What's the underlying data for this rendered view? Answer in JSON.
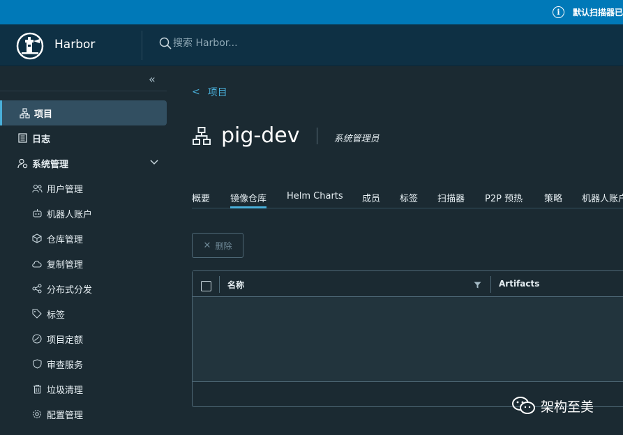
{
  "banner": {
    "message": "默认扫描器已",
    "icon": "info-icon"
  },
  "header": {
    "brand": "Harbor",
    "search_placeholder": "搜索 Harbor..."
  },
  "sidebar": {
    "collapse_icon": "double-chevron-left-icon",
    "items": [
      {
        "label": "项目",
        "icon": "project-icon",
        "active": true
      },
      {
        "label": "日志",
        "icon": "log-icon"
      },
      {
        "label": "系统管理",
        "icon": "admin-icon",
        "expanded": true
      }
    ],
    "sub_items": [
      {
        "label": "用户管理",
        "icon": "users-icon"
      },
      {
        "label": "机器人账户",
        "icon": "robot-icon"
      },
      {
        "label": "仓库管理",
        "icon": "cube-icon"
      },
      {
        "label": "复制管理",
        "icon": "cloud-icon"
      },
      {
        "label": "分布式分发",
        "icon": "share-icon"
      },
      {
        "label": "标签",
        "icon": "tag-icon"
      },
      {
        "label": "项目定额",
        "icon": "quota-icon"
      },
      {
        "label": "审查服务",
        "icon": "shield-icon"
      },
      {
        "label": "垃圾清理",
        "icon": "trash-icon"
      },
      {
        "label": "配置管理",
        "icon": "gear-icon"
      }
    ]
  },
  "main": {
    "back_label": "项目",
    "project_name": "pig-dev",
    "role": "系统管理员",
    "tabs": [
      {
        "label": "概要"
      },
      {
        "label": "镜像仓库",
        "active": true
      },
      {
        "label": "Helm Charts"
      },
      {
        "label": "成员"
      },
      {
        "label": "标签"
      },
      {
        "label": "扫描器"
      },
      {
        "label": "P2P 预热"
      },
      {
        "label": "策略"
      },
      {
        "label": "机器人账户"
      }
    ],
    "delete_label": "删除",
    "grid": {
      "columns": [
        "名称",
        "Artifacts"
      ]
    }
  },
  "watermark": "架构至美"
}
